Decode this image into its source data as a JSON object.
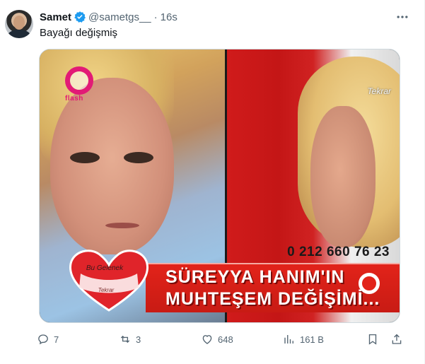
{
  "tweet": {
    "author_name": "Samet",
    "handle": "@sametgs__",
    "separator": "·",
    "time": "16s",
    "text": "Bayağı değişmiş",
    "more_icon": "ellipsis-icon"
  },
  "media": {
    "channel_logo_text": "flash",
    "rerun_text": "Tekrar",
    "phone": "0 212 660 76 23",
    "banner_line1": "SÜREYYA HANIM'IN",
    "banner_line2": "MUHTEŞEM DEĞİŞİMİ...",
    "heart_label": "Bu Gelenek",
    "heart_sublabel": "Tekrar"
  },
  "actions": {
    "replies": "7",
    "retweets": "3",
    "likes": "648",
    "views": "161 B"
  },
  "colors": {
    "verified": "#1d9bf0",
    "icon": "#536471",
    "text": "#0f1419",
    "banner_red": "#e2231a"
  }
}
